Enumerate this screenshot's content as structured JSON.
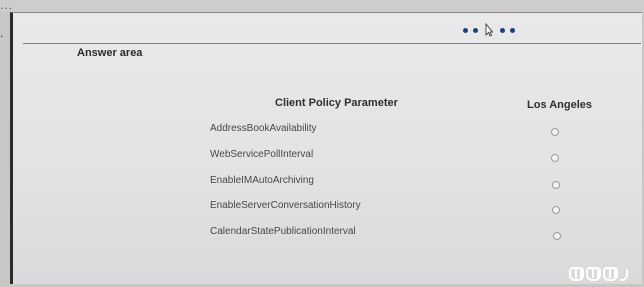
{
  "header": {
    "fragment": "...",
    "marker": "."
  },
  "answer_area": {
    "title": "Answer area",
    "column_parameter": "Client Policy Parameter",
    "column_city": "Los Angeles",
    "rows": [
      {
        "label": "AddressBookAvailability"
      },
      {
        "label": "WebServicePollInterval"
      },
      {
        "label": "EnableIMAutoArchiving"
      },
      {
        "label": "EnableServerConversationHistory"
      },
      {
        "label": "CalendarStatePublicationInterval"
      }
    ]
  },
  "colors": {
    "nav_dots": "#1f3f77",
    "screen_bg": "#e6e6e8",
    "bezel": "#2a2a2a"
  },
  "icons": [
    "pagination-dot",
    "mouse-cursor-icon",
    "watermark-logo-icon"
  ]
}
